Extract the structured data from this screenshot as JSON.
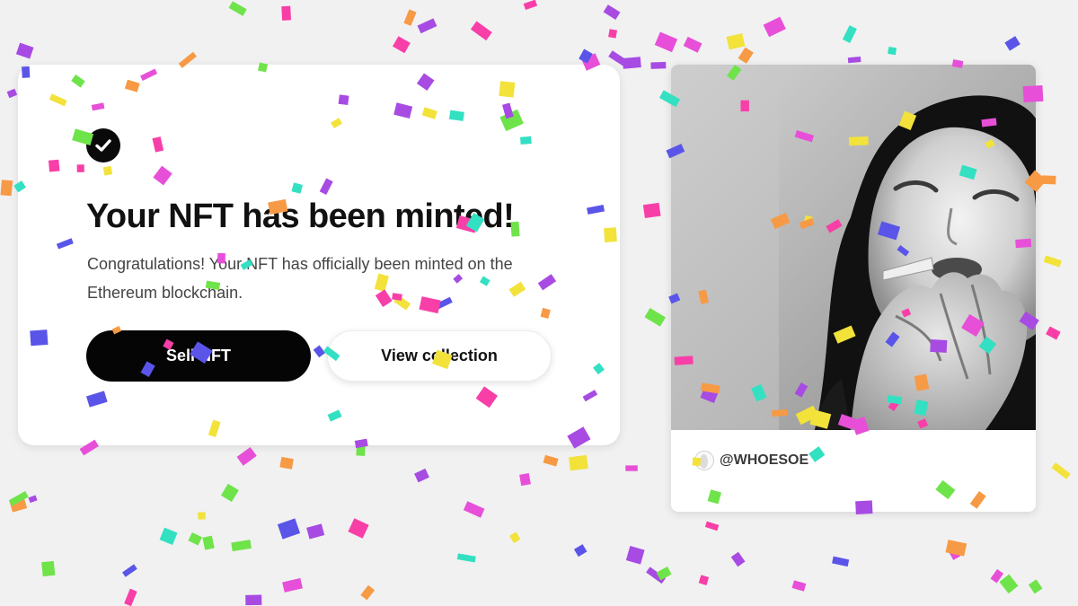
{
  "mint_dialog": {
    "title": "Your NFT has been minted!",
    "description": "Congratulations! Your NFT has officially been minted on the Ethereum blockchain.",
    "sell_button_label": "Sell NFT",
    "view_collection_button_label": "View collection",
    "status_icon": "check-circle-icon"
  },
  "nft_card": {
    "image": "black-and-white-portrait",
    "artist_handle": "@WHOESOE"
  },
  "colors": {
    "background": "#f1f1f1",
    "primary_button": "#050505",
    "confetti": [
      "#f2e23a",
      "#a74be3",
      "#5a55e8",
      "#f83fa8",
      "#6fe34a",
      "#33e0c2",
      "#f79a45",
      "#e74fd8"
    ]
  }
}
